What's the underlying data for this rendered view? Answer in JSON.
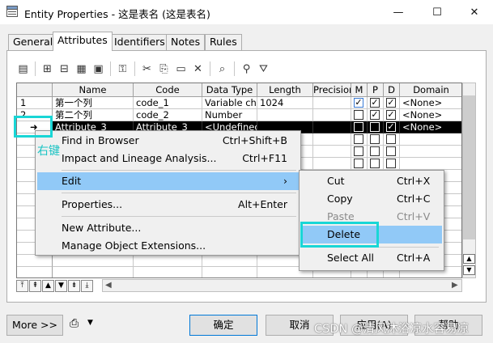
{
  "window": {
    "title": "Entity Properties - 这是表名 (这是表名)",
    "controls": {
      "minimize": "—",
      "maximize": "☐",
      "close": "✕"
    }
  },
  "tabs": [
    "General",
    "Attributes",
    "Identifiers",
    "Notes",
    "Rules"
  ],
  "active_tab": "Attributes",
  "grid": {
    "columns": [
      "Name",
      "Code",
      "Data Type",
      "Length",
      "Precision",
      "M",
      "P",
      "D",
      "Domain"
    ],
    "rows": [
      {
        "num": "1",
        "name": "第一个列",
        "code": "code_1",
        "data_type": "Variable char",
        "length": "1024",
        "precision": "",
        "m": "☑",
        "p": "☑",
        "d": "☑",
        "domain": "<None>"
      },
      {
        "num": "2",
        "name": "第二个列",
        "code": "code_2",
        "data_type": "Number",
        "length": "",
        "precision": "",
        "m": "☐",
        "p": "☑",
        "d": "☑",
        "domain": "<None>"
      },
      {
        "num": "➜",
        "name": "Attribute_3",
        "code": "Attribute_3",
        "data_type": "<Undefined>",
        "length": "",
        "precision": "",
        "m": "☐",
        "p": "☐",
        "d": "☑",
        "domain": "<None>"
      }
    ]
  },
  "context_menu": {
    "items": [
      {
        "label": "Find in Browser",
        "shortcut": "Ctrl+Shift+B"
      },
      {
        "label": "Impact and Lineage Analysis...",
        "shortcut": "Ctrl+F11"
      },
      {
        "label": "Edit",
        "shortcut": "›"
      },
      {
        "label": "Properties...",
        "shortcut": "Alt+Enter"
      },
      {
        "label": "New Attribute...",
        "shortcut": ""
      },
      {
        "label": "Manage Object Extensions...",
        "shortcut": ""
      }
    ]
  },
  "edit_submenu": {
    "items": [
      {
        "label": "Cut",
        "shortcut": "Ctrl+X",
        "enabled": true
      },
      {
        "label": "Copy",
        "shortcut": "Ctrl+C",
        "enabled": true
      },
      {
        "label": "Paste",
        "shortcut": "Ctrl+V",
        "enabled": false
      },
      {
        "label": "Delete",
        "shortcut": "",
        "enabled": true
      },
      {
        "label": "Select All",
        "shortcut": "Ctrl+A",
        "enabled": true
      }
    ]
  },
  "annotation": {
    "right_click_label": "右键"
  },
  "buttons": {
    "more": "More >>",
    "ok": "确定",
    "cancel": "取消",
    "apply": "应用(A)",
    "help": "帮助"
  },
  "watermark": "CSDN @清风沐浴凉水容易凉",
  "colors": {
    "highlight": "#91c9f7",
    "annotation": "#19d6d6",
    "selected_row": "#000000"
  }
}
